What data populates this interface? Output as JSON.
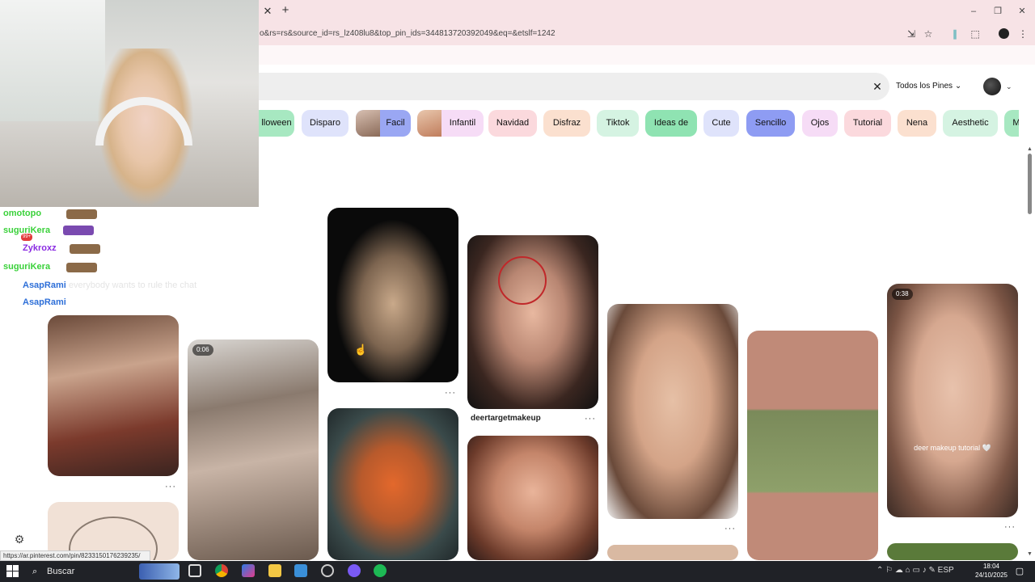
{
  "browser": {
    "tab_close": "✕",
    "tab_new": "+",
    "url": "o&rs=rs&source_id=rs_lz408lu8&top_pin_ids=344813720392049&eq=&etslf=1242",
    "window_controls": [
      "–",
      "❐",
      "✕"
    ],
    "toolbar_icons": [
      "install-icon",
      "star-icon",
      "extension-icon",
      "puzzle-icon",
      "profile-icon",
      "menu-icon"
    ]
  },
  "pinterest": {
    "search_clear": "✕",
    "filter_label": "Todos los Pines",
    "chips": [
      {
        "label": "lloween",
        "color": "#a7e8c1"
      },
      {
        "label": "Disparo",
        "color": "#dfe3fb"
      },
      {
        "label": "Facil",
        "color": "#9aa7f3"
      },
      {
        "label": "Infantil",
        "color": "#f6dcf6"
      },
      {
        "label": "Navidad",
        "color": "#fbd9dd"
      },
      {
        "label": "Disfraz",
        "color": "#fbe0cf"
      },
      {
        "label": "Tiktok",
        "color": "#d5f3e2"
      },
      {
        "label": "Ideas de",
        "color": "#8fe3b2"
      },
      {
        "label": "Cute",
        "color": "#dfe3fb"
      },
      {
        "label": "Sencillo",
        "color": "#8e9cf3"
      },
      {
        "label": "Ojos",
        "color": "#f6dcf6"
      },
      {
        "label": "Tutorial",
        "color": "#fbd9dd"
      },
      {
        "label": "Nena",
        "color": "#fbe0cf"
      },
      {
        "label": "Aesthetic",
        "color": "#d5f3e2"
      },
      {
        "label": "M",
        "color": "#a7e8c1"
      }
    ],
    "pins": {
      "pin4_name": "deertargetmakeup",
      "pin2_duration": "0:06",
      "pin8_duration": "0:38",
      "pin8_caption": "deer makeup tutorial 🤍",
      "more": "···"
    }
  },
  "chat": {
    "lines": [
      {
        "user": "omotopo",
        "color": "#3ad13a"
      },
      {
        "user": "suguriKera",
        "color": "#3ad13a"
      },
      {
        "user": "Zykroxz",
        "color": "#8a2be2"
      },
      {
        "user": "suguriKera",
        "color": "#3ad13a"
      },
      {
        "user": "AsapRami",
        "color": "#2e6fd8",
        "message": "everybody wants to rule the chat"
      },
      {
        "user": "AsapRami",
        "color": "#2e6fd8"
      }
    ],
    "badge_count": "99+"
  },
  "status_url": "https://ar.pinterest.com/pin/8233150176239235/",
  "taskbar": {
    "search_placeholder": "Buscar",
    "language": "ESP",
    "time": "18:04",
    "date": "24/10/2025"
  }
}
